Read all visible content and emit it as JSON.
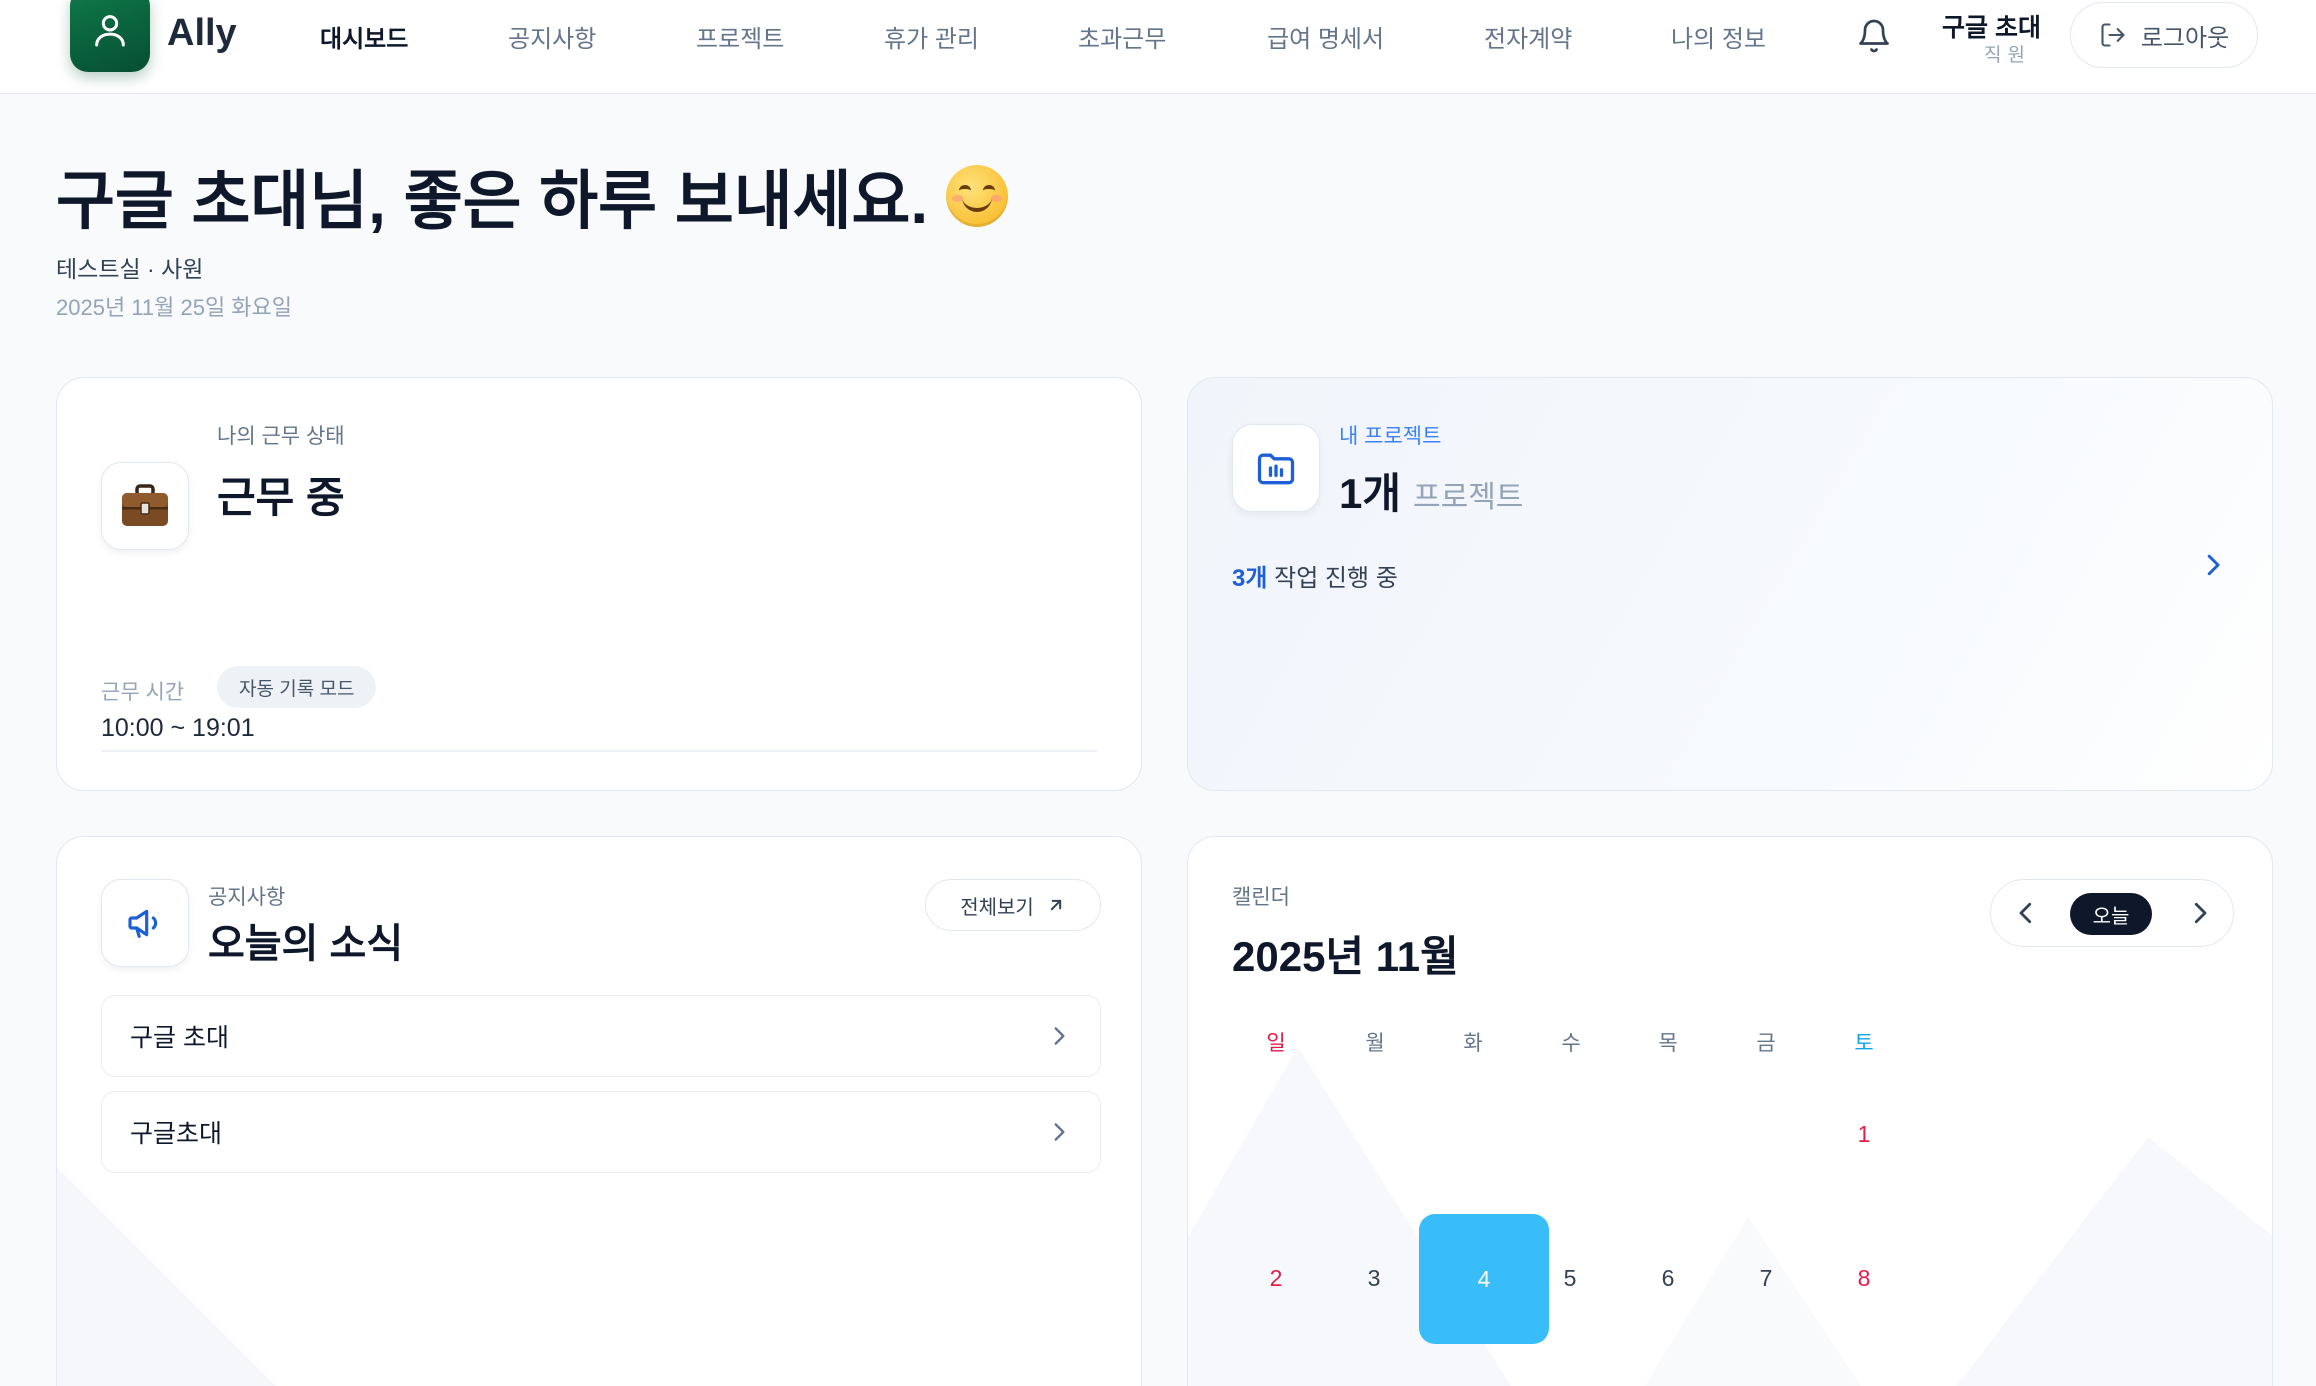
{
  "app": {
    "name": "Ally"
  },
  "nav": [
    "대시보드",
    "공지사항",
    "프로젝트",
    "휴가 관리",
    "초과근무",
    "급여 명세서",
    "전자계약",
    "나의 정보"
  ],
  "nav_active": "대시보드",
  "user": {
    "name": "구글 초대",
    "role": "직원"
  },
  "logout_label": "로그아웃",
  "greeting": {
    "title": "구글 초대님, 좋은 하루 보내세요.",
    "team": "테스트실 · 사원",
    "date": "2025년 11월 25일 화요일"
  },
  "work": {
    "label": "나의 근무 상태",
    "status": "근무 중",
    "mode": "자동 기록 모드",
    "hours_label": "근무 시간",
    "hours": "10:00 ~ 19:01"
  },
  "project": {
    "label": "내 프로젝트",
    "count": "1개",
    "unit": "프로젝트",
    "tasks_count": "3개",
    "tasks_text": "작업 진행 중"
  },
  "notice": {
    "label": "공지사항",
    "title": "오늘의 소식",
    "view_all": "전체보기",
    "items": [
      "구글 초대",
      "구글초대"
    ]
  },
  "calendar": {
    "label": "캘린더",
    "month_title": "2025년 11월",
    "today_button": "오늘",
    "weekdays": [
      "일",
      "월",
      "화",
      "수",
      "목",
      "금",
      "토"
    ],
    "week1": [
      "",
      "",
      "",
      "",
      "",
      "",
      "1"
    ],
    "week2": [
      "2",
      "3",
      "4",
      "5",
      "6",
      "7",
      "8"
    ],
    "selected": "4"
  },
  "colors": {
    "brand": "#0b6b41",
    "accent_blue": "#1d5fd6",
    "selected_day": "#38bdf8",
    "sunday": "#e11d48",
    "saturday": "#0ea5e9"
  }
}
